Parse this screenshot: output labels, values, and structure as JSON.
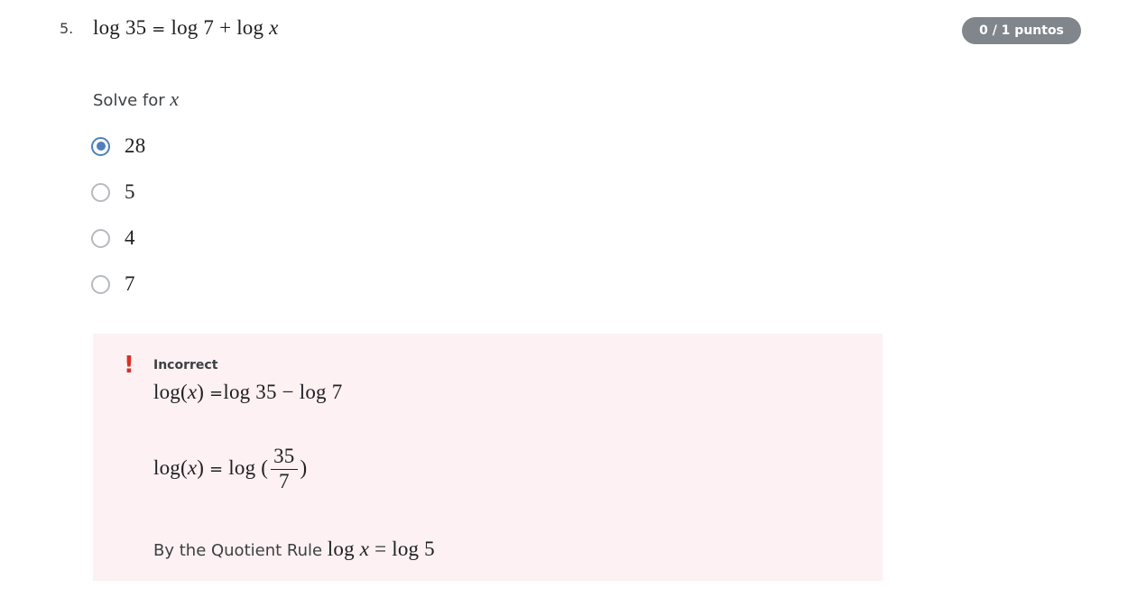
{
  "question": {
    "number": "5.",
    "title": {
      "part1": "log 35",
      "eq": " = ",
      "part2": "log 7 + log ",
      "var": "x"
    },
    "points": "0 / 1 puntos",
    "prompt": {
      "text": "Solve for ",
      "var": "x"
    }
  },
  "options": [
    {
      "value": "28",
      "selected": true
    },
    {
      "value": "5",
      "selected": false
    },
    {
      "value": "4",
      "selected": false
    },
    {
      "value": "7",
      "selected": false
    }
  ],
  "feedback": {
    "verdict": "Incorrect",
    "icon": "exclamation-icon",
    "line1": {
      "lhs": "log(",
      "var": "x",
      "rhs": ")",
      "eq": " =",
      "expr": "log 35 − log 7"
    },
    "line2": {
      "lhs": "log(",
      "var": "x",
      "rhs": ")",
      "eq": " = ",
      "expr": "log (",
      "num": "35",
      "den": "7",
      "close": ")"
    },
    "line3": {
      "text": "By the Quotient Rule ",
      "lhs": "log ",
      "var": "x",
      "expr": " = log 5"
    }
  },
  "colors": {
    "accent": "#4e7fbf",
    "points_badge": "#80868b",
    "feedback_bg": "#fdf1f3",
    "error": "#d93025"
  }
}
